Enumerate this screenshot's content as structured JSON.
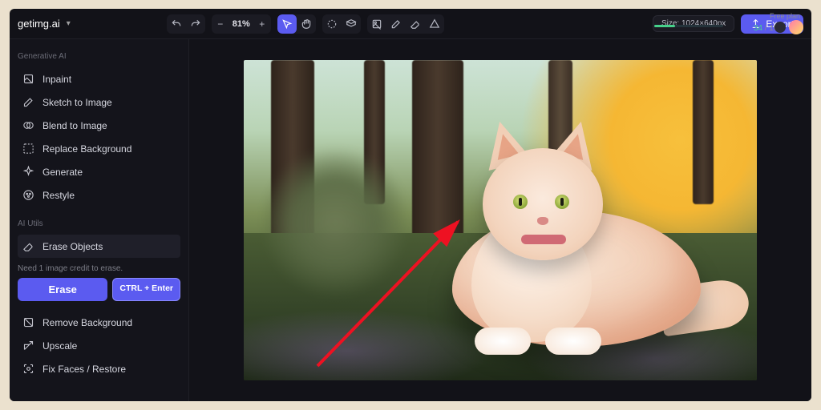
{
  "brand": "getimg.ai",
  "toolbar": {
    "zoom": "81%",
    "size_label": "Size: 1024×640px",
    "export_label": "Export"
  },
  "account": {
    "plan": "Free plan",
    "credits_used": "34",
    "credits_total": "/ 100"
  },
  "sidebar": {
    "gen_head": "Generative AI",
    "gen": [
      {
        "label": "Inpaint"
      },
      {
        "label": "Sketch to Image"
      },
      {
        "label": "Blend to Image"
      },
      {
        "label": "Replace Background"
      },
      {
        "label": "Generate"
      },
      {
        "label": "Restyle"
      }
    ],
    "utils_head": "AI Utils",
    "utils": [
      {
        "label": "Erase Objects"
      },
      {
        "label": "Remove Background"
      },
      {
        "label": "Upscale"
      },
      {
        "label": "Fix Faces / Restore"
      }
    ],
    "erase_hint": "Need 1 image credit to erase.",
    "erase_btn": "Erase",
    "erase_kbd": "CTRL + Enter"
  },
  "canvas": {
    "subject": "fluffy-cream-cat-in-forest"
  }
}
